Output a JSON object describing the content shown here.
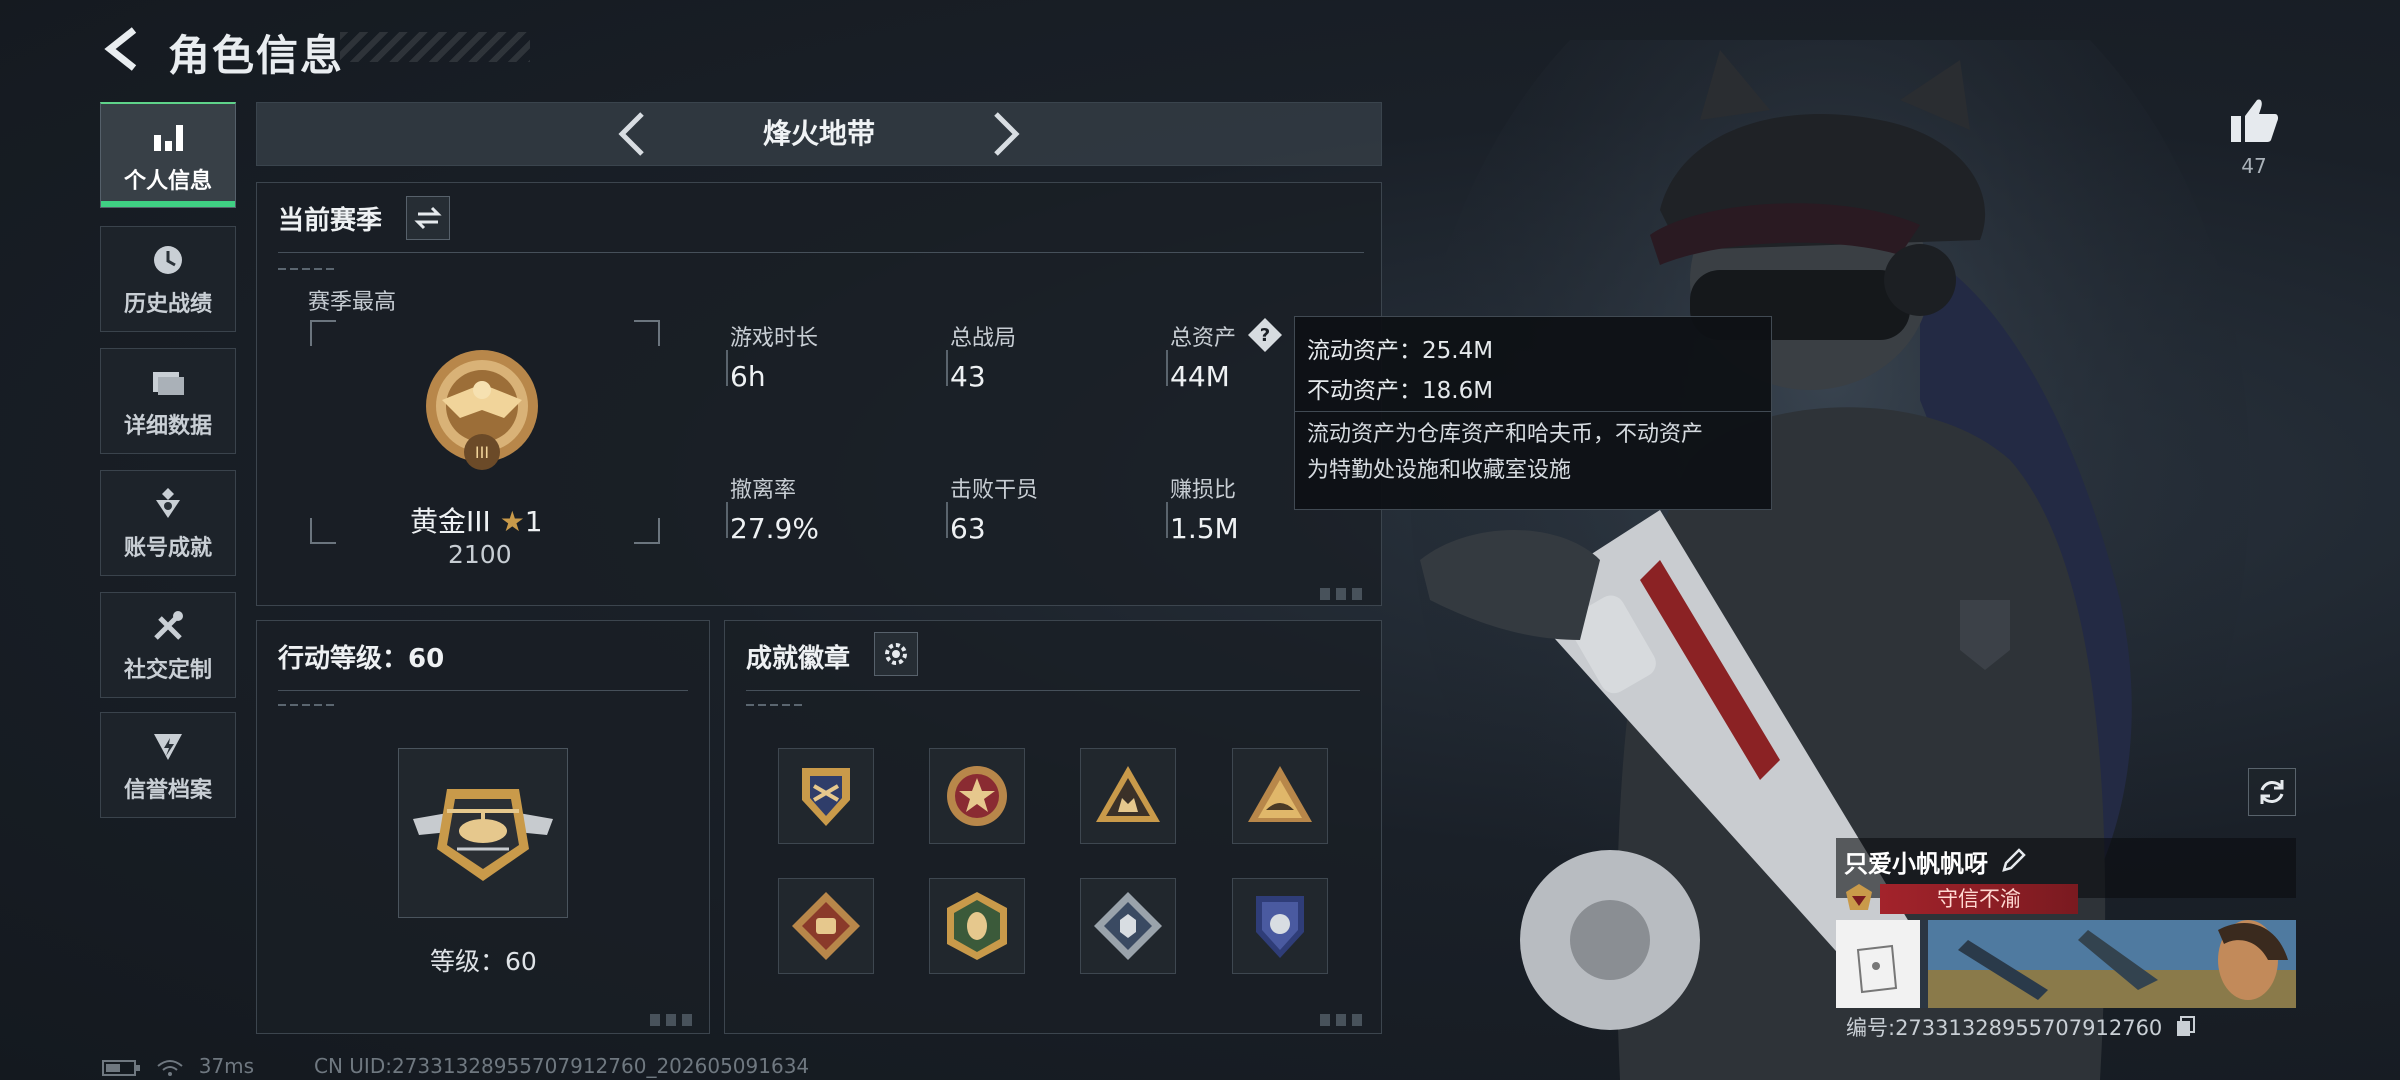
{
  "header": {
    "title": "角色信息"
  },
  "sidebar": {
    "items": [
      {
        "label": "个人信息",
        "icon": "bar-chart-icon",
        "active": true
      },
      {
        "label": "历史战绩",
        "icon": "history-clock-icon"
      },
      {
        "label": "详细数据",
        "icon": "folder-icon"
      },
      {
        "label": "账号成就",
        "icon": "achievement-icon"
      },
      {
        "label": "社交定制",
        "icon": "tools-icon"
      },
      {
        "label": "信誉档案",
        "icon": "reputation-icon"
      }
    ]
  },
  "mode": {
    "title": "烽火地带"
  },
  "season": {
    "title": "当前赛季",
    "best_label": "赛季最高",
    "rank_name": "黄金III",
    "rank_stars": "1",
    "rank_score": "2100",
    "stats": [
      {
        "label": "游戏时长",
        "value": "6h"
      },
      {
        "label": "总战局",
        "value": "43"
      },
      {
        "label": "总资产",
        "value": "44M"
      },
      {
        "label": "撤离率",
        "value": "27.9%"
      },
      {
        "label": "击败干员",
        "value": "63"
      },
      {
        "label": "赚损比",
        "value": "1.5M"
      }
    ]
  },
  "tooltip": {
    "liquid": "流动资产：25.4M",
    "fixed": "不动资产：18.6M",
    "note_line1": "流动资产为仓库资产和哈夫币，不动资产",
    "note_line2": "为特勤处设施和收藏室设施"
  },
  "level_panel": {
    "title": "行动等级：60",
    "level_text": "等级：60"
  },
  "badges_panel": {
    "title": "成就徽章",
    "badges": [
      "badge-shield-icon",
      "badge-star-icon",
      "badge-triangle-squad-icon",
      "badge-triangle-emblem-icon",
      "badge-diamond-fist-icon",
      "badge-hex-bee-icon",
      "badge-diamond-cube-icon",
      "badge-shield-blue-icon"
    ]
  },
  "likes": {
    "count": "47"
  },
  "player": {
    "name": "只爱小帆帆呀",
    "reputation": "守信不渝",
    "id_text": "编号:27331328955707912760"
  },
  "status": {
    "ping": "37ms",
    "uid": "CN UID:27331328955707912760_202605091634"
  },
  "colors": {
    "accent_green": "#3fd083",
    "reputation_red": "#a3232b",
    "rank_gold": "#c99a4a"
  }
}
